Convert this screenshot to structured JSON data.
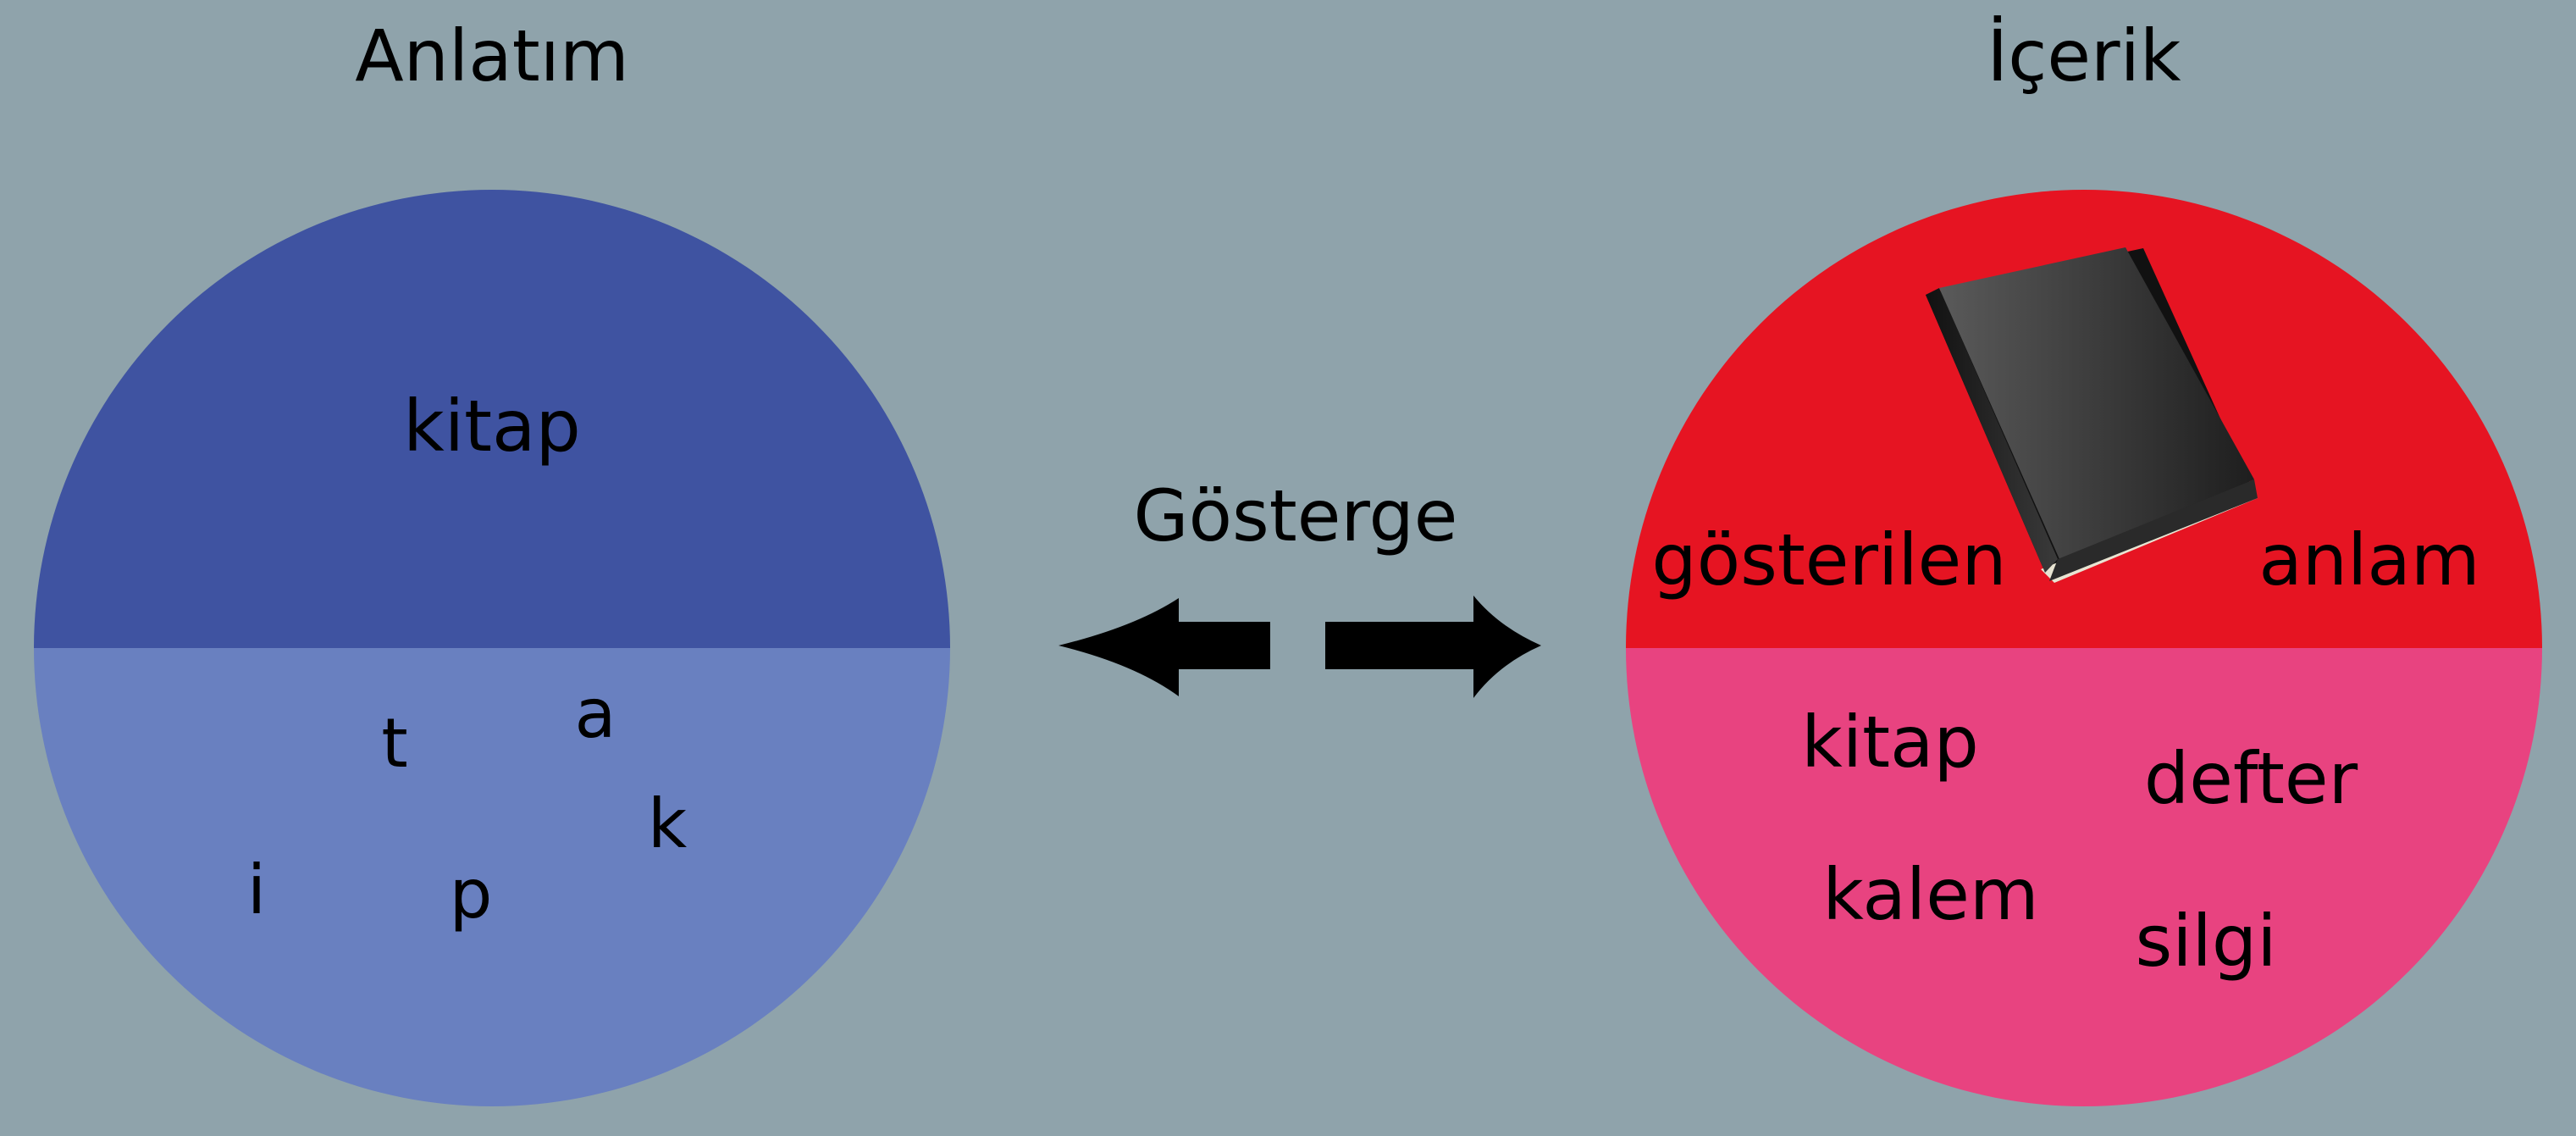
{
  "background_color": "#8fa3ab",
  "left_panel": {
    "title": "Anlatım",
    "top_word": "kitap",
    "letters": [
      "t",
      "a",
      "k",
      "i",
      "p"
    ],
    "top_color": "#3f53a1",
    "bottom_color": "#6980c0"
  },
  "center": {
    "label": "Gösterge",
    "left_arrow_icon": "arrow-left-icon",
    "right_arrow_icon": "arrow-right-icon"
  },
  "right_panel": {
    "title": "İçerik",
    "top_left_word": "gösterilen",
    "top_right_word": "anlam",
    "book_icon": "book-icon",
    "bottom_words": [
      "kitap",
      "defter",
      "kalem",
      "silgi"
    ],
    "top_color": "#e61422",
    "bottom_color": "#e84380"
  }
}
